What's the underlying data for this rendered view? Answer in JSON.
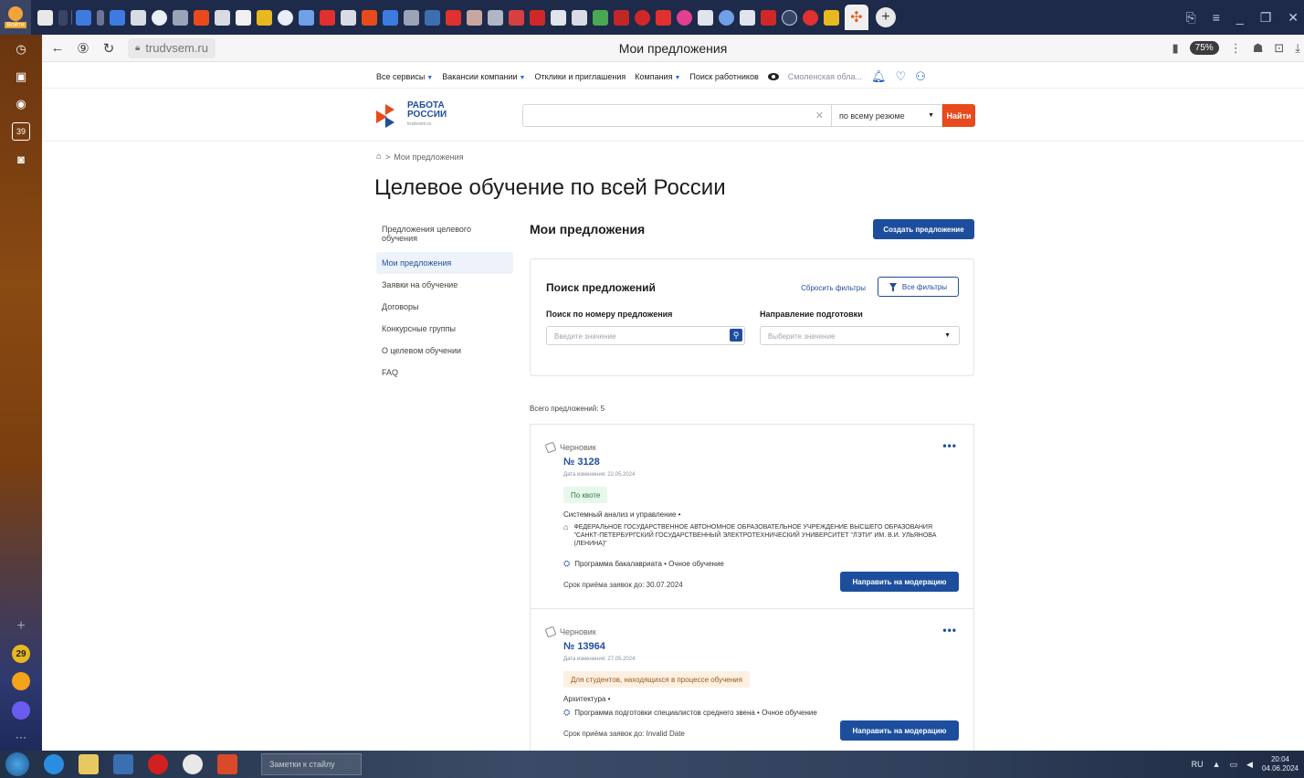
{
  "browser": {
    "login_label": "Войти",
    "url": "trudvsem.ru",
    "page_title": "Мои предложения",
    "zoom": "75%",
    "sidebar_badge_count": "29",
    "calendar_day": "39"
  },
  "site_nav": {
    "items": [
      {
        "label": "Все сервисы",
        "caret": true
      },
      {
        "label": "Вакансии компании",
        "caret": true
      },
      {
        "label": "Отклики и приглашения",
        "caret": false
      },
      {
        "label": "Компания",
        "caret": true
      },
      {
        "label": "Поиск работников",
        "caret": false
      }
    ],
    "region": "Смоленская обла..."
  },
  "logo": {
    "line1": "РАБОТА",
    "line2": "РОССИИ",
    "line3": "trudvsem.ru"
  },
  "search": {
    "placeholder": "",
    "scope": "по всему резюме",
    "button": "Найти"
  },
  "breadcrumb": {
    "current": "Мои предложения"
  },
  "page_heading": "Целевое обучение по всей России",
  "left_nav": [
    {
      "label": "Предложения целевого обучения",
      "active": false
    },
    {
      "label": "Мои предложения",
      "active": true
    },
    {
      "label": "Заявки на обучение",
      "active": false
    },
    {
      "label": "Договоры",
      "active": false
    },
    {
      "label": "Конкурсные группы",
      "active": false
    },
    {
      "label": "О целевом обучении",
      "active": false
    },
    {
      "label": "FAQ",
      "active": false
    }
  ],
  "main": {
    "title": "Мои предложения",
    "create_button": "Создать предложение",
    "filters": {
      "title": "Поиск предложений",
      "reset": "Сбросить фильтры",
      "all_filters": "Все фильтры",
      "number_label": "Поиск по номеру предложения",
      "number_placeholder": "Введите значение",
      "direction_label": "Направление подготовки",
      "direction_placeholder": "Выберите значение"
    },
    "total": "Всего предложений: 5",
    "offers": [
      {
        "status": "Черновик",
        "number": "№ 3128",
        "date": "Дата изменения: 22.05.2024",
        "badge": "По квоте",
        "specialty": "Системный анализ и управление •",
        "org": "ФЕДЕРАЛЬНОЕ ГОСУДАРСТВЕННОЕ АВТОНОМНОЕ ОБРАЗОВАТЕЛЬНОЕ УЧРЕЖДЕНИЕ ВЫСШЕГО ОБРАЗОВАНИЯ \"САНКТ-ПЕТЕРБУРГСКИЙ ГОСУДАРСТВЕННЫЙ ЭЛЕКТРОТЕХНИЧЕСКИЙ УНИВЕРСИТЕТ \"ЛЭТИ\" ИМ. В.И. УЛЬЯНОВА (ЛЕНИНА)\"",
        "program": "Программа бакалавриата • Очное обучение",
        "deadline": "Срок приёма заявок до: 30.07.2024",
        "action": "Направить на модерацию"
      },
      {
        "status": "Черновик",
        "number": "№ 13964",
        "date": "Дата изменения: 27.05.2024",
        "badge": "Для студентов, находящихся в процессе обучения",
        "specialty": "Архитектура •",
        "org": "",
        "program": "Программа подготовки специалистов среднего звена • Очное обучение",
        "deadline": "Срок приёма заявок до: Invalid Date",
        "action": "Направить на модерацию"
      }
    ]
  },
  "taskbar": {
    "window_label": "Заметки к стайлу",
    "lang": "RU",
    "time": "20:04",
    "date": "04.06.2024"
  },
  "colors": {
    "brand_blue": "#1d4e9e",
    "brand_orange": "#e84a1b",
    "badge_green_bg": "#e7f7ec",
    "badge_orange_bg": "#fdf0e2"
  }
}
